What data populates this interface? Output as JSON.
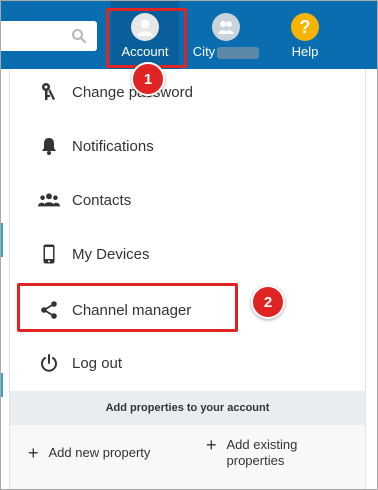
{
  "topbar": {
    "search_placeholder": "",
    "nav": {
      "account_label": "Account",
      "city_label": "City",
      "help_label": "Help",
      "help_glyph": "?"
    }
  },
  "menu": {
    "items": [
      {
        "label": "Change password",
        "icon": "key-icon"
      },
      {
        "label": "Notifications",
        "icon": "bell-icon"
      },
      {
        "label": "Contacts",
        "icon": "people-icon"
      },
      {
        "label": "My Devices",
        "icon": "phone-icon"
      },
      {
        "label": "Channel manager",
        "icon": "share-icon"
      },
      {
        "label": "Log out",
        "icon": "power-icon"
      }
    ]
  },
  "footer": {
    "heading": "Add properties to your account",
    "add_new": "Add new property",
    "add_existing": "Add existing properties",
    "plus_glyph": "+"
  },
  "annotations": {
    "callout_1": "1",
    "callout_2": "2",
    "color": "#e02424"
  },
  "colors": {
    "topbar": "#0a6db0",
    "help_icon": "#f6b400"
  }
}
